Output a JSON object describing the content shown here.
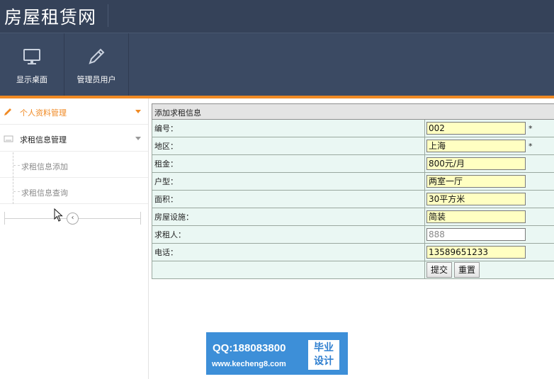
{
  "header": {
    "title": "房屋租赁网"
  },
  "toolbar": {
    "items": [
      {
        "label": "显示桌面",
        "icon": "monitor-icon"
      },
      {
        "label": "管理员用户",
        "icon": "pencil-icon"
      }
    ]
  },
  "sidebar": {
    "groups": [
      {
        "label": "个人资料管理",
        "icon": "pencil-icon",
        "active": true
      },
      {
        "label": "求租信息管理",
        "icon": "keyboard-icon",
        "active": false
      }
    ],
    "items": [
      {
        "label": "求租信息添加"
      },
      {
        "label": "求租信息查询"
      }
    ],
    "collapse_icon": "chevron-left-icon"
  },
  "form": {
    "caption": "添加求租信息",
    "fields": [
      {
        "label": "编号：",
        "value": "002",
        "required": "*"
      },
      {
        "label": "地区：",
        "value": "上海",
        "required": "*"
      },
      {
        "label": "租金：",
        "value": "800元/月",
        "required": ""
      },
      {
        "label": "户型：",
        "value": "两室一厅",
        "required": ""
      },
      {
        "label": "面积：",
        "value": "30平方米",
        "required": ""
      },
      {
        "label": "房屋设施：",
        "value": "简装",
        "required": ""
      },
      {
        "label": "求租人：",
        "value": "888",
        "required": ""
      },
      {
        "label": "电话：",
        "value": "13589651233",
        "required": ""
      }
    ],
    "submit_label": "提交",
    "reset_label": "重置"
  },
  "watermark": {
    "qq": "QQ:188083800",
    "site": "www.kecheng8.com",
    "badge_line1": "毕业",
    "badge_line2": "设计"
  },
  "colors": {
    "header_bg": "#354259",
    "toolbar_bg": "#3b4a63",
    "accent": "#f08a24",
    "input_bg": "#ffffc2",
    "row_bg": "#eaf7f3"
  }
}
